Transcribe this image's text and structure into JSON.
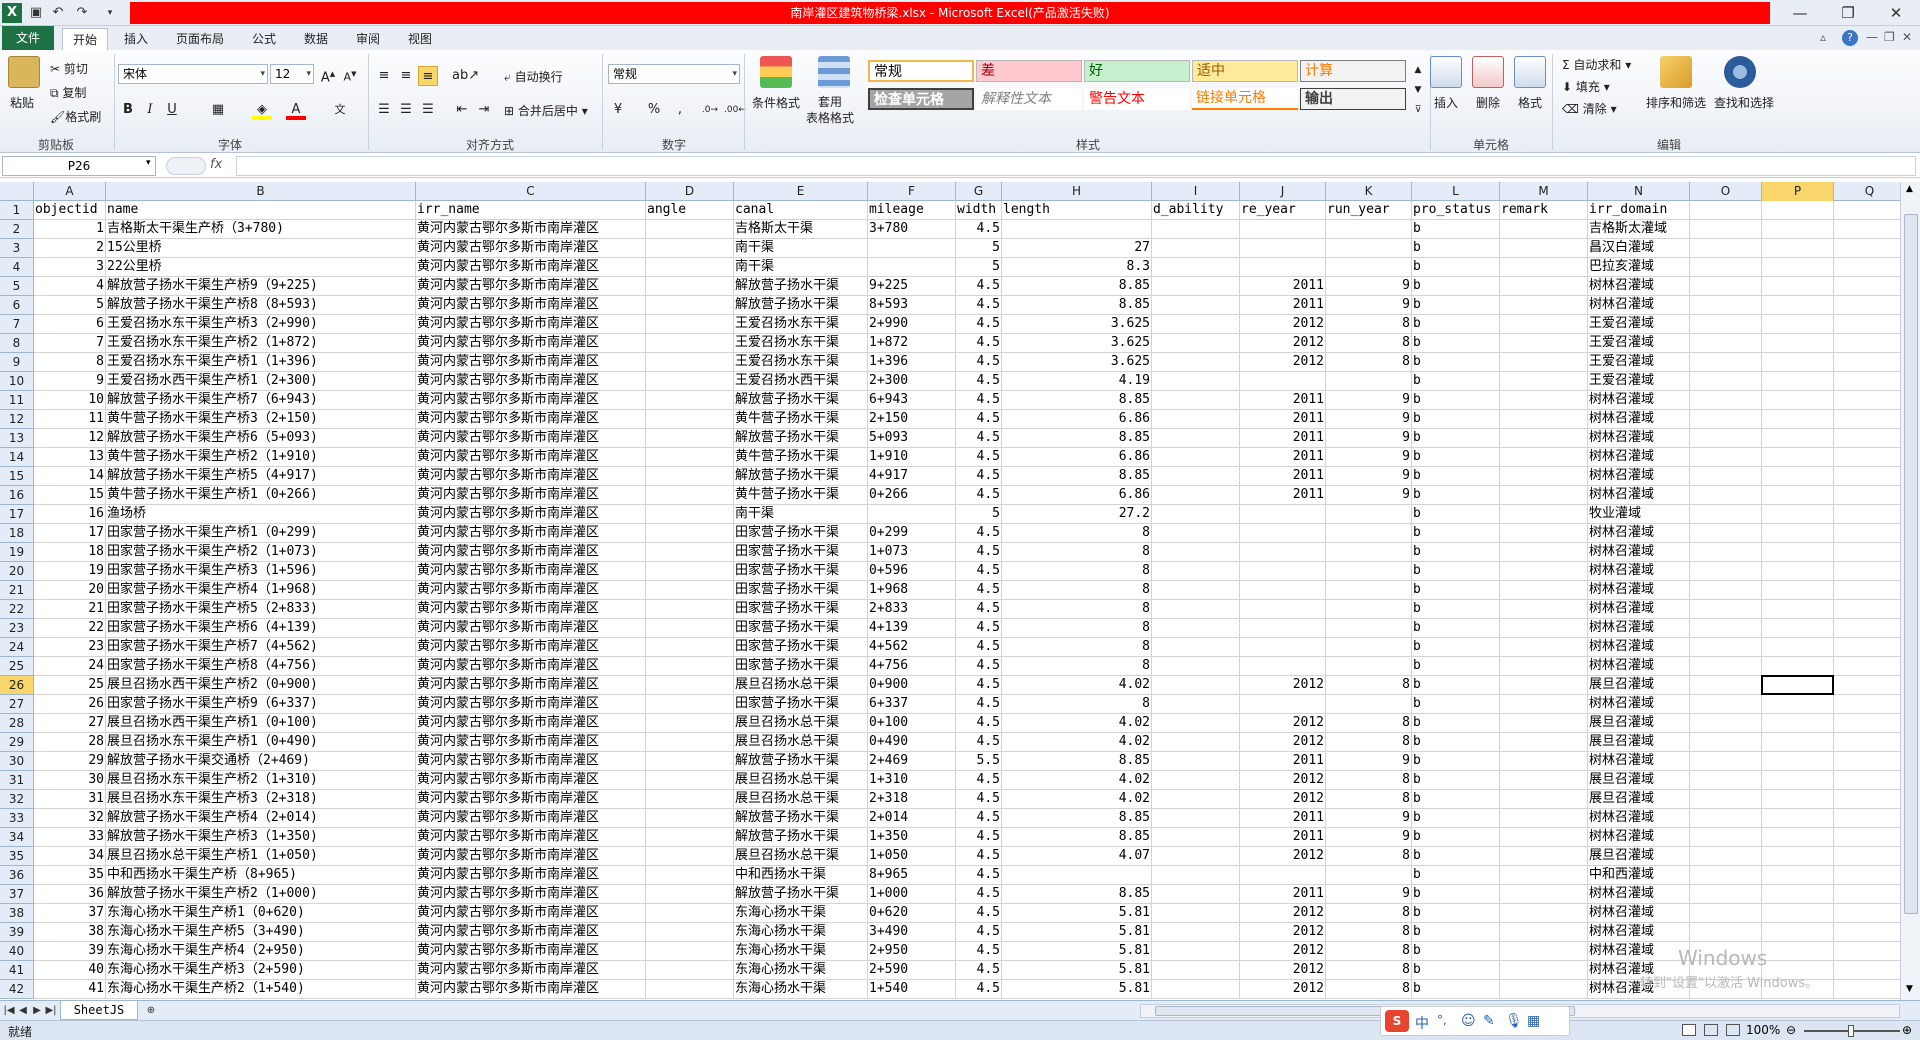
{
  "window": {
    "title": "南岸灌区建筑物桥梁.xlsx - Microsoft Excel(产品激活失败)",
    "minimize_label": "—",
    "restore_label": "❐",
    "close_label": "✕"
  },
  "tabs": [
    "文件",
    "开始",
    "插入",
    "页面布局",
    "公式",
    "数据",
    "审阅",
    "视图"
  ],
  "ribbon": {
    "clipboard": {
      "paste": "粘贴",
      "cut": "剪切",
      "copy": "复制",
      "format_painter": "格式刷",
      "label": "剪贴板"
    },
    "font": {
      "name": "宋体",
      "size": "12",
      "label": "字体"
    },
    "alignment": {
      "wrap": "自动换行",
      "merge": "合并后居中",
      "label": "对齐方式"
    },
    "number": {
      "format": "常规",
      "label": "数字"
    },
    "styles": {
      "cond_format": "条件格式",
      "table_format": "套用\n表格格式",
      "cells": [
        "常规",
        "差",
        "好",
        "适中",
        "计算",
        "检查单元格",
        "解释性文本",
        "警告文本",
        "链接单元格",
        "输出"
      ],
      "label": "样式"
    },
    "cells_group": {
      "insert": "插入",
      "delete": "删除",
      "format": "格式",
      "label": "单元格"
    },
    "editing": {
      "autosum": "自动求和",
      "fill": "填充",
      "clear": "清除",
      "sort": "排序和筛选",
      "find": "查找和选择",
      "label": "编辑"
    },
    "colors": {
      "accent": "#1e7145",
      "title_red": "#ff0000",
      "selection": "#f8d66b"
    }
  },
  "formula_bar": {
    "name_box": "P26",
    "fx": "fx",
    "value": ""
  },
  "columns": [
    {
      "letter": "A",
      "w": 72
    },
    {
      "letter": "B",
      "w": 310
    },
    {
      "letter": "C",
      "w": 230
    },
    {
      "letter": "D",
      "w": 88
    },
    {
      "letter": "E",
      "w": 134
    },
    {
      "letter": "F",
      "w": 88
    },
    {
      "letter": "G",
      "w": 46
    },
    {
      "letter": "H",
      "w": 150
    },
    {
      "letter": "I",
      "w": 88
    },
    {
      "letter": "J",
      "w": 86
    },
    {
      "letter": "K",
      "w": 86
    },
    {
      "letter": "L",
      "w": 88
    },
    {
      "letter": "M",
      "w": 88
    },
    {
      "letter": "N",
      "w": 102
    },
    {
      "letter": "O",
      "w": 72
    },
    {
      "letter": "P",
      "w": 72
    },
    {
      "letter": "Q",
      "w": 72
    }
  ],
  "header_row": [
    "objectid",
    "name",
    "irr_name",
    "angle",
    "canal",
    "mileage",
    "width",
    "length",
    "d_ability",
    "re_year",
    "run_year",
    "pro_status",
    "remark",
    "irr_domain",
    "",
    "",
    ""
  ],
  "rows": [
    [
      "1",
      "吉格斯太干渠生产桥（3+780)",
      "黄河内蒙古鄂尔多斯市南岸灌区",
      "",
      "吉格斯太干渠",
      "3+780",
      "4.5",
      "",
      "",
      "",
      "",
      "b",
      "",
      "吉格斯太灌域"
    ],
    [
      "2",
      "15公里桥",
      "黄河内蒙古鄂尔多斯市南岸灌区",
      "",
      "南干渠",
      "",
      "5",
      "27",
      "",
      "",
      "",
      "b",
      "",
      "昌汉白灌域"
    ],
    [
      "3",
      "22公里桥",
      "黄河内蒙古鄂尔多斯市南岸灌区",
      "",
      "南干渠",
      "",
      "5",
      "8.3",
      "",
      "",
      "",
      "b",
      "",
      "巴拉亥灌域"
    ],
    [
      "4",
      "解放营子扬水干渠生产桥9（9+225)",
      "黄河内蒙古鄂尔多斯市南岸灌区",
      "",
      "解放营子扬水干渠",
      "9+225",
      "4.5",
      "8.85",
      "",
      "2011",
      "9",
      "b",
      "",
      "树林召灌域"
    ],
    [
      "5",
      "解放营子扬水干渠生产桥8（8+593)",
      "黄河内蒙古鄂尔多斯市南岸灌区",
      "",
      "解放营子扬水干渠",
      "8+593",
      "4.5",
      "8.85",
      "",
      "2011",
      "9",
      "b",
      "",
      "树林召灌域"
    ],
    [
      "6",
      "王爱召扬水东干渠生产桥3（2+990)",
      "黄河内蒙古鄂尔多斯市南岸灌区",
      "",
      "王爱召扬水东干渠",
      "2+990",
      "4.5",
      "3.625",
      "",
      "2012",
      "8",
      "b",
      "",
      "王爱召灌域"
    ],
    [
      "7",
      "王爱召扬水东干渠生产桥2（1+872)",
      "黄河内蒙古鄂尔多斯市南岸灌区",
      "",
      "王爱召扬水东干渠",
      "1+872",
      "4.5",
      "3.625",
      "",
      "2012",
      "8",
      "b",
      "",
      "王爱召灌域"
    ],
    [
      "8",
      "王爱召扬水东干渠生产桥1（1+396)",
      "黄河内蒙古鄂尔多斯市南岸灌区",
      "",
      "王爱召扬水东干渠",
      "1+396",
      "4.5",
      "3.625",
      "",
      "2012",
      "8",
      "b",
      "",
      "王爱召灌域"
    ],
    [
      "9",
      "王爱召扬水西干渠生产桥1（2+300)",
      "黄河内蒙古鄂尔多斯市南岸灌区",
      "",
      "王爱召扬水西干渠",
      "2+300",
      "4.5",
      "4.19",
      "",
      "",
      "",
      "b",
      "",
      "王爱召灌域"
    ],
    [
      "10",
      "解放营子扬水干渠生产桥7（6+943)",
      "黄河内蒙古鄂尔多斯市南岸灌区",
      "",
      "解放营子扬水干渠",
      "6+943",
      "4.5",
      "8.85",
      "",
      "2011",
      "9",
      "b",
      "",
      "树林召灌域"
    ],
    [
      "11",
      "黄牛营子扬水干渠生产桥3（2+150)",
      "黄河内蒙古鄂尔多斯市南岸灌区",
      "",
      "黄牛营子扬水干渠",
      "2+150",
      "4.5",
      "6.86",
      "",
      "2011",
      "9",
      "b",
      "",
      "树林召灌域"
    ],
    [
      "12",
      "解放营子扬水干渠生产桥6（5+093)",
      "黄河内蒙古鄂尔多斯市南岸灌区",
      "",
      "解放营子扬水干渠",
      "5+093",
      "4.5",
      "8.85",
      "",
      "2011",
      "9",
      "b",
      "",
      "树林召灌域"
    ],
    [
      "13",
      "黄牛营子扬水干渠生产桥2（1+910)",
      "黄河内蒙古鄂尔多斯市南岸灌区",
      "",
      "黄牛营子扬水干渠",
      "1+910",
      "4.5",
      "6.86",
      "",
      "2011",
      "9",
      "b",
      "",
      "树林召灌域"
    ],
    [
      "14",
      "解放营子扬水干渠生产桥5（4+917)",
      "黄河内蒙古鄂尔多斯市南岸灌区",
      "",
      "解放营子扬水干渠",
      "4+917",
      "4.5",
      "8.85",
      "",
      "2011",
      "9",
      "b",
      "",
      "树林召灌域"
    ],
    [
      "15",
      "黄牛营子扬水干渠生产桥1（0+266)",
      "黄河内蒙古鄂尔多斯市南岸灌区",
      "",
      "黄牛营子扬水干渠",
      "0+266",
      "4.5",
      "6.86",
      "",
      "2011",
      "9",
      "b",
      "",
      "树林召灌域"
    ],
    [
      "16",
      "渔场桥",
      "黄河内蒙古鄂尔多斯市南岸灌区",
      "",
      "南干渠",
      "",
      "5",
      "27.2",
      "",
      "",
      "",
      "b",
      "",
      "牧业灌域"
    ],
    [
      "17",
      "田家营子扬水干渠生产桥1（0+299)",
      "黄河内蒙古鄂尔多斯市南岸灌区",
      "",
      "田家营子扬水干渠",
      "0+299",
      "4.5",
      "8",
      "",
      "",
      "",
      "b",
      "",
      "树林召灌域"
    ],
    [
      "18",
      "田家营子扬水干渠生产桥2（1+073)",
      "黄河内蒙古鄂尔多斯市南岸灌区",
      "",
      "田家营子扬水干渠",
      "1+073",
      "4.5",
      "8",
      "",
      "",
      "",
      "b",
      "",
      "树林召灌域"
    ],
    [
      "19",
      "田家营子扬水干渠生产桥3（1+596)",
      "黄河内蒙古鄂尔多斯市南岸灌区",
      "",
      "田家营子扬水干渠",
      "0+596",
      "4.5",
      "8",
      "",
      "",
      "",
      "b",
      "",
      "树林召灌域"
    ],
    [
      "20",
      "田家营子扬水干渠生产桥4（1+968)",
      "黄河内蒙古鄂尔多斯市南岸灌区",
      "",
      "田家营子扬水干渠",
      "1+968",
      "4.5",
      "8",
      "",
      "",
      "",
      "b",
      "",
      "树林召灌域"
    ],
    [
      "21",
      "田家营子扬水干渠生产桥5（2+833)",
      "黄河内蒙古鄂尔多斯市南岸灌区",
      "",
      "田家营子扬水干渠",
      "2+833",
      "4.5",
      "8",
      "",
      "",
      "",
      "b",
      "",
      "树林召灌域"
    ],
    [
      "22",
      "田家营子扬水干渠生产桥6（4+139)",
      "黄河内蒙古鄂尔多斯市南岸灌区",
      "",
      "田家营子扬水干渠",
      "4+139",
      "4.5",
      "8",
      "",
      "",
      "",
      "b",
      "",
      "树林召灌域"
    ],
    [
      "23",
      "田家营子扬水干渠生产桥7（4+562)",
      "黄河内蒙古鄂尔多斯市南岸灌区",
      "",
      "田家营子扬水干渠",
      "4+562",
      "4.5",
      "8",
      "",
      "",
      "",
      "b",
      "",
      "树林召灌域"
    ],
    [
      "24",
      "田家营子扬水干渠生产桥8（4+756)",
      "黄河内蒙古鄂尔多斯市南岸灌区",
      "",
      "田家营子扬水干渠",
      "4+756",
      "4.5",
      "8",
      "",
      "",
      "",
      "b",
      "",
      "树林召灌域"
    ],
    [
      "25",
      "展旦召扬水西干渠生产桥2（0+900)",
      "黄河内蒙古鄂尔多斯市南岸灌区",
      "",
      "展旦召扬水总干渠",
      "0+900",
      "4.5",
      "4.02",
      "",
      "2012",
      "8",
      "b",
      "",
      "展旦召灌域"
    ],
    [
      "26",
      "田家营子扬水干渠生产桥9（6+337)",
      "黄河内蒙古鄂尔多斯市南岸灌区",
      "",
      "田家营子扬水干渠",
      "6+337",
      "4.5",
      "8",
      "",
      "",
      "",
      "b",
      "",
      "树林召灌域"
    ],
    [
      "27",
      "展旦召扬水西干渠生产桥1（0+100)",
      "黄河内蒙古鄂尔多斯市南岸灌区",
      "",
      "展旦召扬水总干渠",
      "0+100",
      "4.5",
      "4.02",
      "",
      "2012",
      "8",
      "b",
      "",
      "展旦召灌域"
    ],
    [
      "28",
      "展旦召扬水东干渠生产桥1（0+490)",
      "黄河内蒙古鄂尔多斯市南岸灌区",
      "",
      "展旦召扬水总干渠",
      "0+490",
      "4.5",
      "4.02",
      "",
      "2012",
      "8",
      "b",
      "",
      "展旦召灌域"
    ],
    [
      "29",
      "解放营子扬水干渠交通桥（2+469)",
      "黄河内蒙古鄂尔多斯市南岸灌区",
      "",
      "解放营子扬水干渠",
      "2+469",
      "5.5",
      "8.85",
      "",
      "2011",
      "9",
      "b",
      "",
      "树林召灌域"
    ],
    [
      "30",
      "展旦召扬水东干渠生产桥2（1+310)",
      "黄河内蒙古鄂尔多斯市南岸灌区",
      "",
      "展旦召扬水总干渠",
      "1+310",
      "4.5",
      "4.02",
      "",
      "2012",
      "8",
      "b",
      "",
      "展旦召灌域"
    ],
    [
      "31",
      "展旦召扬水东干渠生产桥3（2+318)",
      "黄河内蒙古鄂尔多斯市南岸灌区",
      "",
      "展旦召扬水总干渠",
      "2+318",
      "4.5",
      "4.02",
      "",
      "2012",
      "8",
      "b",
      "",
      "展旦召灌域"
    ],
    [
      "32",
      "解放营子扬水干渠生产桥4（2+014)",
      "黄河内蒙古鄂尔多斯市南岸灌区",
      "",
      "解放营子扬水干渠",
      "2+014",
      "4.5",
      "8.85",
      "",
      "2011",
      "9",
      "b",
      "",
      "树林召灌域"
    ],
    [
      "33",
      "解放营子扬水干渠生产桥3（1+350)",
      "黄河内蒙古鄂尔多斯市南岸灌区",
      "",
      "解放营子扬水干渠",
      "1+350",
      "4.5",
      "8.85",
      "",
      "2011",
      "9",
      "b",
      "",
      "树林召灌域"
    ],
    [
      "34",
      "展旦召扬水总干渠生产桥1（1+050)",
      "黄河内蒙古鄂尔多斯市南岸灌区",
      "",
      "展旦召扬水总干渠",
      "1+050",
      "4.5",
      "4.07",
      "",
      "2012",
      "8",
      "b",
      "",
      "展旦召灌域"
    ],
    [
      "35",
      "中和西扬水干渠生产桥（8+965)",
      "黄河内蒙古鄂尔多斯市南岸灌区",
      "",
      "中和西扬水干渠",
      "8+965",
      "4.5",
      "",
      "",
      "",
      "",
      "b",
      "",
      "中和西灌域"
    ],
    [
      "36",
      "解放营子扬水干渠生产桥2（1+000)",
      "黄河内蒙古鄂尔多斯市南岸灌区",
      "",
      "解放营子扬水干渠",
      "1+000",
      "4.5",
      "8.85",
      "",
      "2011",
      "9",
      "b",
      "",
      "树林召灌域"
    ],
    [
      "37",
      "东海心扬水干渠生产桥1（0+620)",
      "黄河内蒙古鄂尔多斯市南岸灌区",
      "",
      "东海心扬水干渠",
      "0+620",
      "4.5",
      "5.81",
      "",
      "2012",
      "8",
      "b",
      "",
      "树林召灌域"
    ],
    [
      "38",
      "东海心扬水干渠生产桥5（3+490)",
      "黄河内蒙古鄂尔多斯市南岸灌区",
      "",
      "东海心扬水干渠",
      "3+490",
      "4.5",
      "5.81",
      "",
      "2012",
      "8",
      "b",
      "",
      "树林召灌域"
    ],
    [
      "39",
      "东海心扬水干渠生产桥4（2+950)",
      "黄河内蒙古鄂尔多斯市南岸灌区",
      "",
      "东海心扬水干渠",
      "2+950",
      "4.5",
      "5.81",
      "",
      "2012",
      "8",
      "b",
      "",
      "树林召灌域"
    ],
    [
      "40",
      "东海心扬水干渠生产桥3（2+590)",
      "黄河内蒙古鄂尔多斯市南岸灌区",
      "",
      "东海心扬水干渠",
      "2+590",
      "4.5",
      "5.81",
      "",
      "2012",
      "8",
      "b",
      "",
      "树林召灌域"
    ],
    [
      "41",
      "东海心扬水干渠生产桥2（1+540)",
      "黄河内蒙古鄂尔多斯市南岸灌区",
      "",
      "东海心扬水干渠",
      "1+540",
      "4.5",
      "5.81",
      "",
      "2012",
      "8",
      "b",
      "",
      "树林召灌域"
    ]
  ],
  "selected_cell": {
    "ref": "P26",
    "col": "P",
    "row": "26"
  },
  "sheet_tab": "SheetJS",
  "status": {
    "ready": "就绪",
    "zoom": "100%"
  },
  "watermark": {
    "line1": "Windows",
    "line2": "转到\"设置\"以激活 Windows。"
  },
  "ime": {
    "lang": "中",
    "punct": "°,"
  }
}
